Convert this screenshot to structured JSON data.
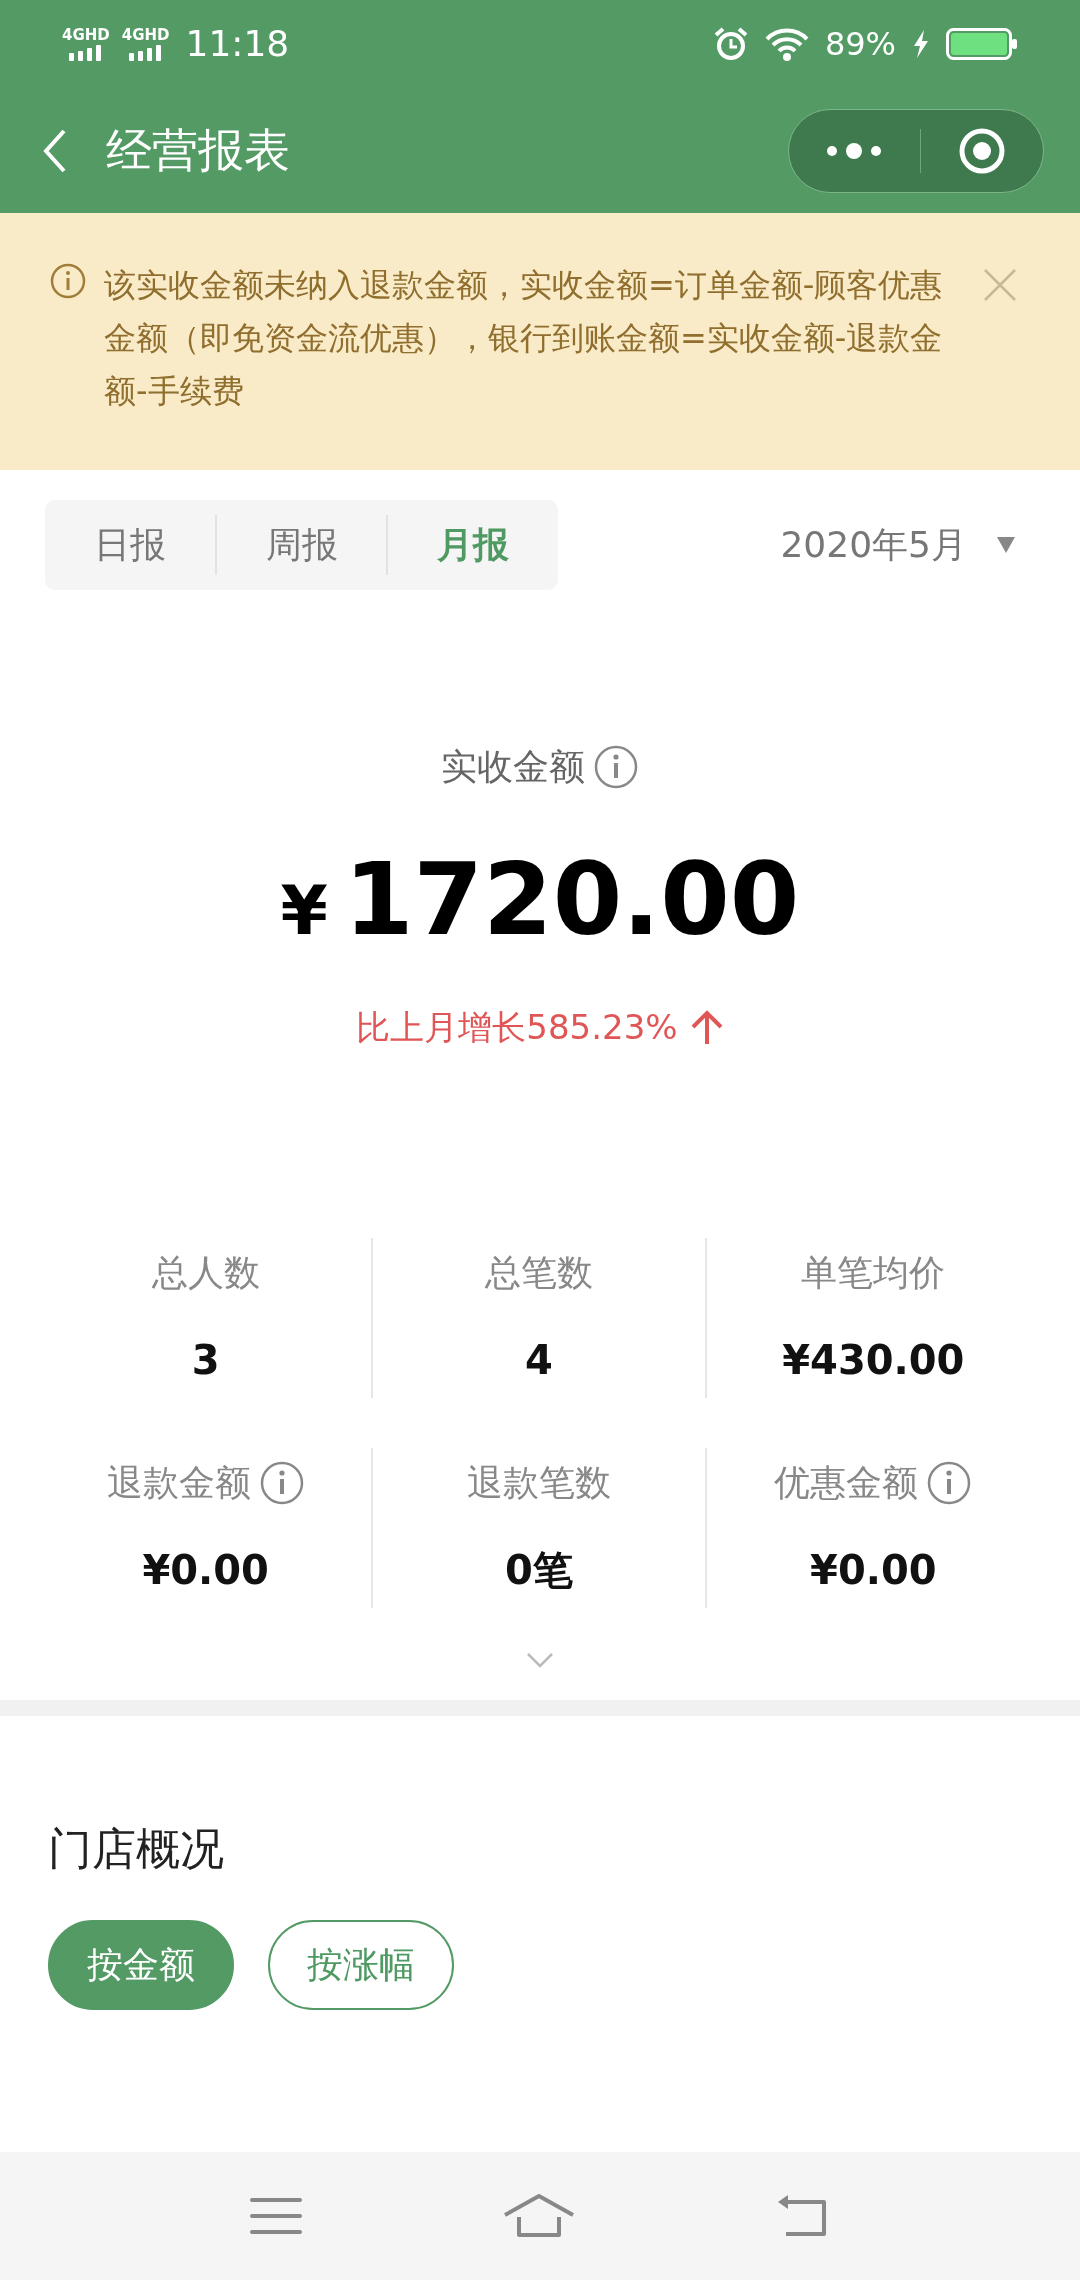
{
  "status_bar": {
    "network_1": "4GHD",
    "network_2": "4GHD",
    "time": "11:18",
    "battery": "89%"
  },
  "header": {
    "title": "经营报表"
  },
  "notice": {
    "text": "该实收金额未纳入退款金额，实收金额=订单金额-顾客优惠金额（即免资金流优惠），银行到账金额=实收金额-退款金额-手续费"
  },
  "tabs": [
    {
      "label": "日报",
      "selected": false
    },
    {
      "label": "周报",
      "selected": false
    },
    {
      "label": "月报",
      "selected": true
    }
  ],
  "date_picker": {
    "value": "2020年5月"
  },
  "summary": {
    "label": "实收金额",
    "currency": "¥",
    "amount": "1720.00",
    "growth": "比上月增长585.23%"
  },
  "stats": [
    {
      "label": "总人数",
      "value": "3",
      "info": false
    },
    {
      "label": "总笔数",
      "value": "4",
      "info": false
    },
    {
      "label": "单笔均价",
      "value": "¥430.00",
      "info": false
    },
    {
      "label": "退款金额",
      "value": "¥0.00",
      "info": true
    },
    {
      "label": "退款笔数",
      "value": "0笔",
      "info": false
    },
    {
      "label": "优惠金额",
      "value": "¥0.00",
      "info": true
    }
  ],
  "store_overview": {
    "title": "门店概况",
    "filters": [
      {
        "label": "按金额",
        "selected": true
      },
      {
        "label": "按涨幅",
        "selected": false
      }
    ]
  }
}
